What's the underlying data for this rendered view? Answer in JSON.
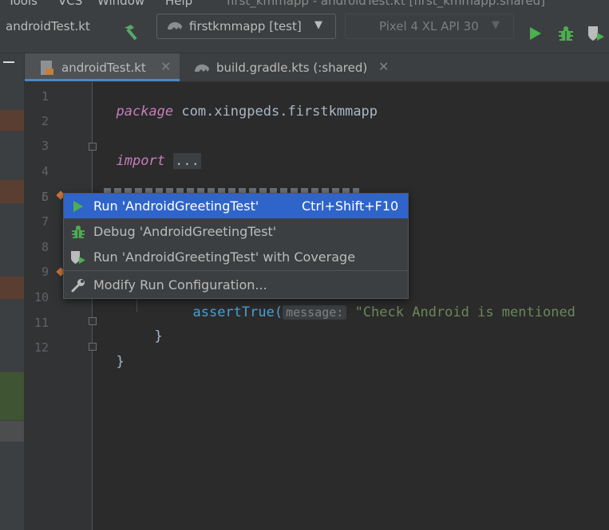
{
  "menu": {
    "items": [
      "Tools",
      "VCS",
      "Window",
      "Help"
    ],
    "window_title": "first_kmmapp - androidTest.kt [first_kmmapp.shared]"
  },
  "toolbar": {
    "file_crumb": "androidTest.kt",
    "run_config": "firstkmmapp [test]",
    "device": "Pixel 4 XL API 30"
  },
  "tabs": [
    {
      "label": "androidTest.kt",
      "active": true
    },
    {
      "label": "build.gradle.kts (:shared)",
      "active": false
    }
  ],
  "editor": {
    "line_numbers": [
      "1",
      "2",
      "3",
      "4",
      "5",
      "6",
      "7",
      "8",
      "9",
      "10",
      "11",
      "12"
    ],
    "line1": {
      "keyword": "package",
      "name": "com.xingpeds.firstkmmapp"
    },
    "line3": {
      "keyword": "import",
      "folded": "..."
    },
    "line10": {
      "call": "assertTrue(",
      "hint": "message:",
      "string": "\"Check Android is mentioned"
    },
    "line11": "}",
    "line12": "}"
  },
  "popup": {
    "items": [
      {
        "label": "Run 'AndroidGreetingTest'",
        "shortcut": "Ctrl+Shift+F10",
        "icon": "run-icon",
        "selected": true
      },
      {
        "label": "Debug 'AndroidGreetingTest'",
        "icon": "debug-icon"
      },
      {
        "label": "Run 'AndroidGreetingTest' with Coverage",
        "icon": "coverage-icon"
      },
      {
        "label": "Modify Run Configuration...",
        "icon": "wrench-icon"
      }
    ]
  },
  "colors": {
    "accent": "#2f65ca",
    "run_green": "#4caf50",
    "tab_underline": "#4a88c7"
  }
}
